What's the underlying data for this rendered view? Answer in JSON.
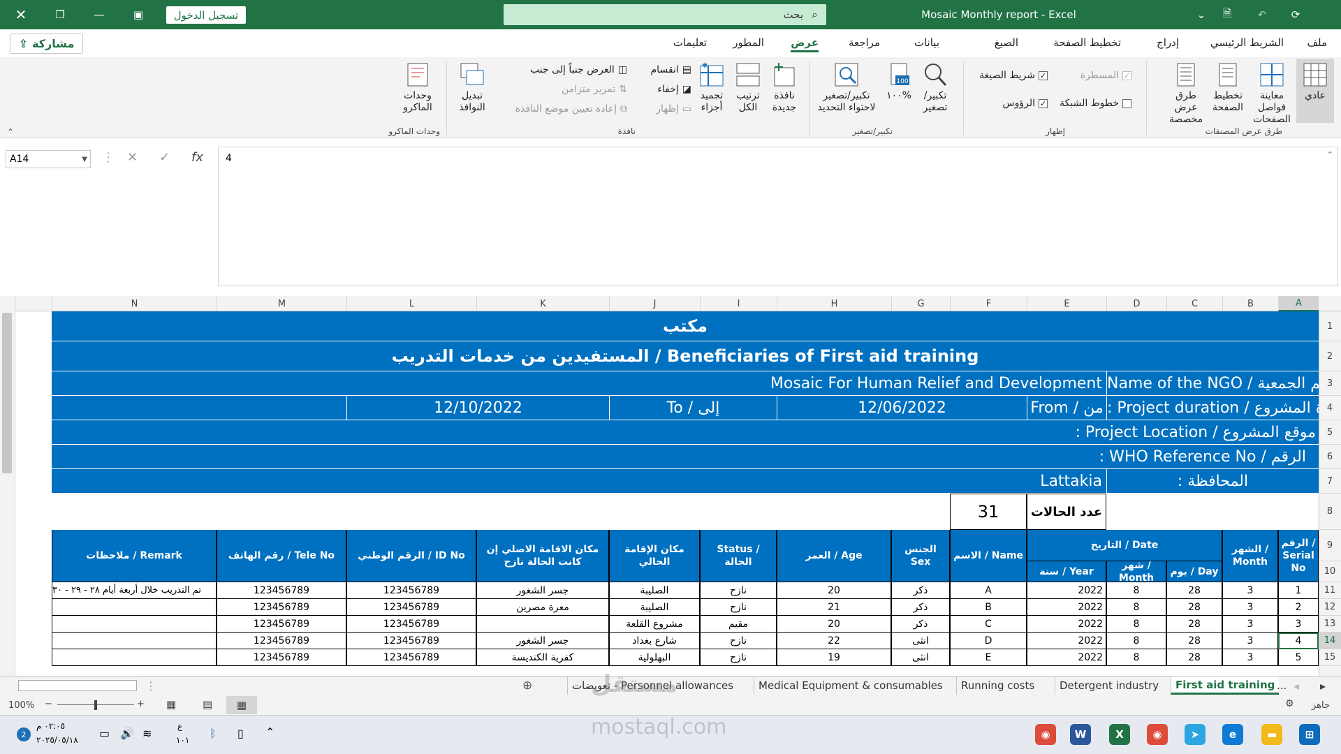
{
  "window": {
    "title": "Mosaic Monthly report  -  Excel",
    "search_placeholder": "بحث",
    "signin": "تسجيل الدخول"
  },
  "share": {
    "label": "مشاركة"
  },
  "tabs": [
    "ملف",
    "الشريط الرئيسي",
    "إدراج",
    "تخطيط الصفحة",
    "الصيغ",
    "بيانات",
    "مراجعة",
    "عرض",
    "المطور",
    "تعليمات"
  ],
  "active_tab": "عرض",
  "ribbon": {
    "views_group": "طرق عرض المصنفات",
    "normal": "عادي",
    "page_break": "معاينة فواصل الصفحات",
    "page_layout": "تخطيط الصفحة",
    "custom_views": "طرق عرض مخصصة",
    "show_group": "إظهار",
    "ruler": "المسطرة",
    "formula_bar": "شريط الصيغة",
    "gridlines": "خطوط الشبكة",
    "headings": "الرؤوس",
    "zoom_group": "تكبير/تصغير",
    "zoom": "تكبير/ تصغير",
    "zoom100": "١٠٠%",
    "zoom_sel": "تكبير/تصغير لاحتواء التحديد",
    "window_group": "نافذة",
    "new_window": "نافذة جديدة",
    "arrange_all": "ترتيب الكل",
    "freeze": "تجميد أجزاء",
    "split": "انقسام",
    "hide": "إخفاء",
    "unhide": "إظهار",
    "side_by_side": "العرض جنباً إلى جنب",
    "sync_scroll": "تمرير متزامن",
    "reset_pos": "إعادة تعيين موضع النافذة",
    "switch_windows": "تبديل النوافذ",
    "macros_group": "وحدات الماكرو",
    "macros": "وحدات الماكرو"
  },
  "formula": {
    "cell": "A14",
    "value": "4"
  },
  "columns": [
    "A",
    "B",
    "C",
    "D",
    "E",
    "F",
    "G",
    "H",
    "I",
    "J",
    "K",
    "L",
    "M",
    "N"
  ],
  "rows": [
    "1",
    "2",
    "3",
    "4",
    "5",
    "6",
    "7",
    "8",
    "9",
    "10",
    "11",
    "12",
    "13",
    "14",
    "15"
  ],
  "sheet": {
    "office": "مكتب",
    "title": "المستفيدين من خدمات التدريب / Beneficiaries of First aid training",
    "ngo_label": "اسم الجمعية / Name of the NGO",
    "ngo_value": "Mosaic For Human Relief and Development",
    "duration_label": "مدة المشروع / Project duration :",
    "from_label": "من / From",
    "from_value": "12/06/2022",
    "to_label": "إلى / To",
    "to_value": "12/10/2022",
    "location_label": "موقع المشروع / Project Location :",
    "who_label": "الرقم / WHO Reference No :",
    "gov_label": "المحافظة :",
    "gov_value": "Lattakia",
    "cases_label": "عدد الحالات",
    "cases_value": "31",
    "headers": {
      "serial": "الرقم / Serial No",
      "month": "الشهر / Month",
      "date": "التاريخ / Date",
      "day": "يوم / Day",
      "dmonth": "شهر / Month",
      "year": "سنة / Year",
      "name": "الاسم / Name",
      "sex": "الجنس Sex",
      "age": "العمر / Age",
      "status": "Status / الحالة",
      "residence": "مكان الإقامة الحالي",
      "origin": "مكان الاقامة الاصلي إن كانت الحالة نازح",
      "id": "الرقم الوطني / ID No",
      "tele": "رقم الهاتف / Tele No",
      "remark": "ملاحظات / Remark"
    },
    "data": [
      {
        "serial": "1",
        "month": "3",
        "day": "28",
        "dmonth": "8",
        "year": "2022",
        "name": "A",
        "sex": "ذكر",
        "age": "20",
        "status": "نازح",
        "residence": "الصليبة",
        "origin": "جسر الشغور",
        "id": "123456789",
        "tele": "123456789",
        "remark": "تم التدريب خلال أربعة أيام ٢٨ - ٢٩ - ٣٠"
      },
      {
        "serial": "2",
        "month": "3",
        "day": "28",
        "dmonth": "8",
        "year": "2022",
        "name": "B",
        "sex": "ذكر",
        "age": "21",
        "status": "نازح",
        "residence": "الصليبة",
        "origin": "معرة مصرين",
        "id": "123456789",
        "tele": "123456789",
        "remark": ""
      },
      {
        "serial": "3",
        "month": "3",
        "day": "28",
        "dmonth": "8",
        "year": "2022",
        "name": "C",
        "sex": "ذكر",
        "age": "20",
        "status": "مقيم",
        "residence": "مشروع القلعة",
        "origin": "",
        "id": "123456789",
        "tele": "123456789",
        "remark": ""
      },
      {
        "serial": "4",
        "month": "3",
        "day": "28",
        "dmonth": "8",
        "year": "2022",
        "name": "D",
        "sex": "انثى",
        "age": "22",
        "status": "نازح",
        "residence": "شارع بغداد",
        "origin": "جسر الشغور",
        "id": "123456789",
        "tele": "123456789",
        "remark": ""
      },
      {
        "serial": "5",
        "month": "3",
        "day": "28",
        "dmonth": "8",
        "year": "2022",
        "name": "E",
        "sex": "انثى",
        "age": "19",
        "status": "نازح",
        "residence": "البهلولية",
        "origin": "كفرية الكنديسة",
        "id": "123456789",
        "tele": "123456789",
        "remark": ""
      }
    ]
  },
  "sheet_tabs": [
    "First aid training",
    "Detergent industry",
    "Running costs",
    "Medical Equipment & consumables",
    "تعويضات - Personnel allowances",
    "..."
  ],
  "status": {
    "ready": "جاهز",
    "zoom": "100%"
  },
  "taskbar": {
    "time": "٠٢:٠٥ م",
    "date": "٢٠٢٥/٠٥/١٨",
    "lang": "ع",
    "lang2": "١٠١"
  },
  "watermark": {
    "brand": "مستقل",
    "site": "mostaql.com"
  },
  "colors": {
    "excel_green": "#217346",
    "table_blue": "#0070c0"
  }
}
